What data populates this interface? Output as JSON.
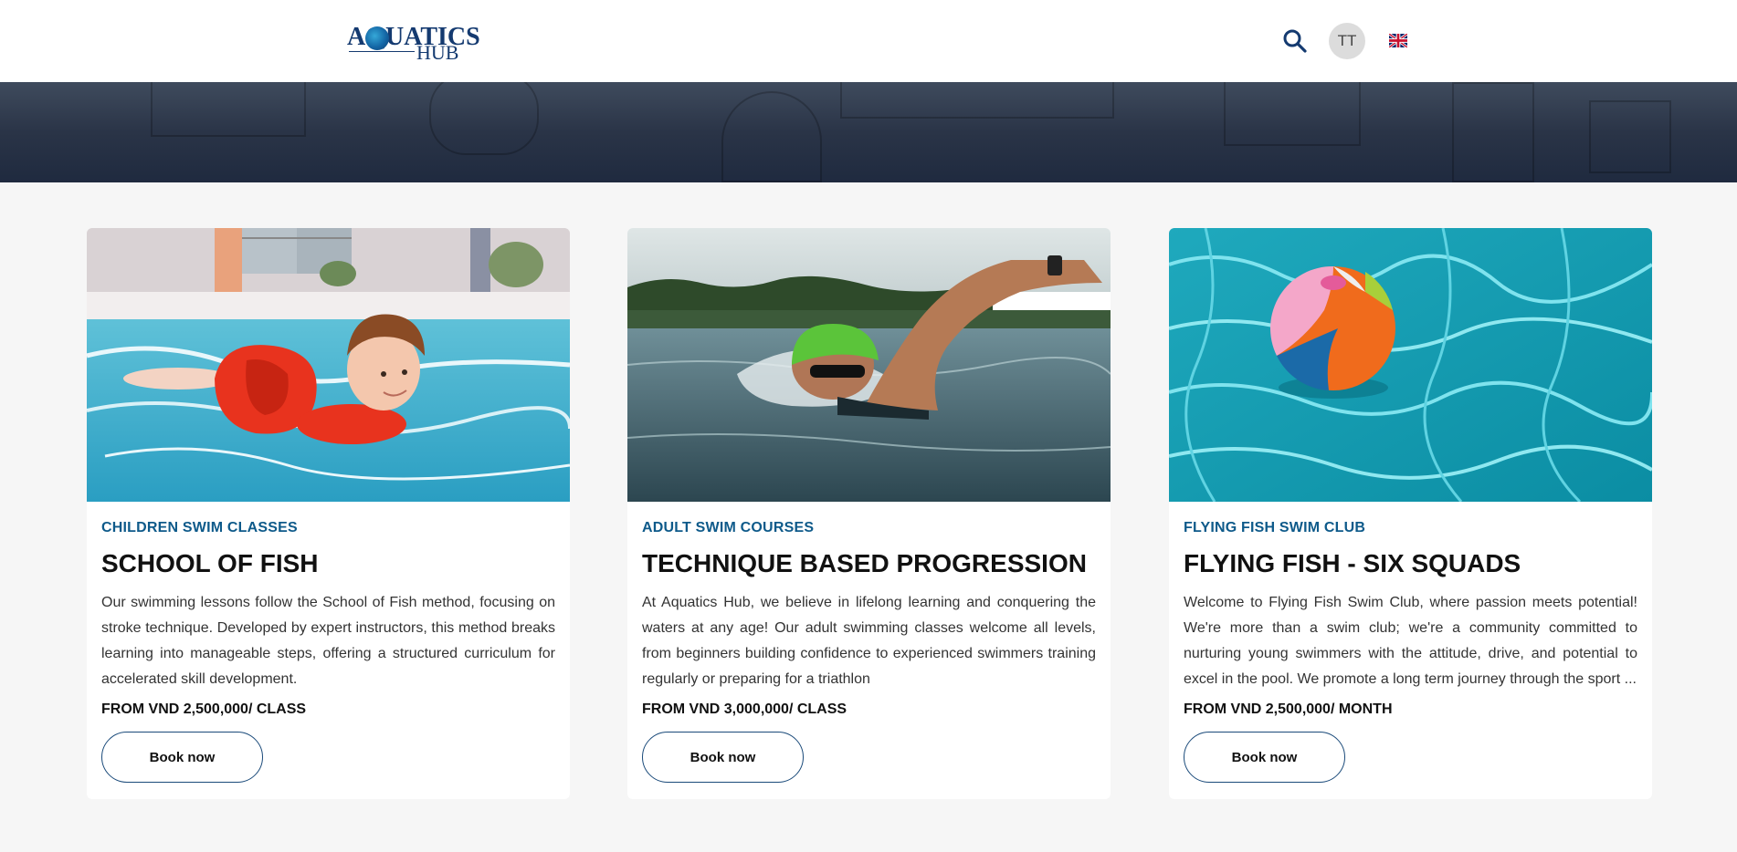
{
  "header": {
    "logo_line1": "AQUATICS",
    "logo_line2": "HUB",
    "avatar_initials": "TT",
    "search_icon": "search-icon",
    "language_icon": "uk-flag-icon"
  },
  "colors": {
    "brand": "#143a70",
    "category": "#0e5a8a",
    "button_border": "#1a4a7a",
    "page_bg": "#f6f6f6"
  },
  "cards": [
    {
      "category": "CHILDREN SWIM CLASSES",
      "title": "SCHOOL OF FISH",
      "description": "Our swimming lessons follow the School of Fish method, focusing on stroke technique. Developed by expert instructors, this method breaks learning into manageable steps, offering a structured curriculum for accelerated skill development.",
      "price": "FROM VND 2,500,000/ CLASS",
      "button": "Book now"
    },
    {
      "category": "ADULT SWIM COURSES",
      "title": "TECHNIQUE BASED PROGRESSION",
      "description": "At Aquatics Hub, we believe in lifelong learning and conquering the waters at any age! Our adult swimming classes welcome all levels, from beginners building confidence to experienced swimmers training regularly or preparing for a triathlon",
      "price": "FROM VND 3,000,000/ CLASS",
      "button": "Book now"
    },
    {
      "category": "FLYING FISH SWIM CLUB",
      "title": "FLYING FISH - SIX SQUADS",
      "description": "Welcome to Flying Fish Swim Club, where passion meets potential! We're more than a swim club; we're a community committed to nurturing young swimmers with the attitude, drive, and potential to excel in the pool. We promote a long term journey through the sport ...",
      "price": "FROM VND 2,500,000/ MONTH",
      "button": "Book now"
    }
  ]
}
